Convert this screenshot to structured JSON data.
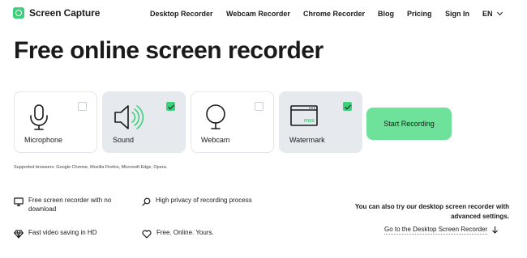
{
  "brand": {
    "name": "Screen Capture",
    "color": "#3ecf7a"
  },
  "nav": {
    "items": [
      "Desktop Recorder",
      "Webcam Recorder",
      "Chrome Recorder",
      "Blog",
      "Pricing",
      "Sign In"
    ],
    "language": "EN"
  },
  "hero": {
    "title": "Free online screen recorder"
  },
  "options": [
    {
      "label": "Microphone",
      "checked": false,
      "icon": "microphone-icon"
    },
    {
      "label": "Sound",
      "checked": true,
      "icon": "speaker-icon"
    },
    {
      "label": "Webcam",
      "checked": false,
      "icon": "webcam-icon"
    },
    {
      "label": "Watermark",
      "checked": true,
      "icon": "watermark-icon",
      "badge": "FREE"
    }
  ],
  "start_button": {
    "label": "Start Recording",
    "color": "#6ee29a"
  },
  "supported_browsers": "Supported browsers: Google Chrome, Mozilla Firefox, Microsoft Edge, Opera.",
  "features": [
    {
      "text": "Free screen recorder with no download",
      "icon": "monitor-icon"
    },
    {
      "text": "High privacy of recording process",
      "icon": "search-icon"
    },
    {
      "text": "Fast video saving in HD",
      "icon": "diamond-icon"
    },
    {
      "text": "Free. Online. Yours.",
      "icon": "heart-icon"
    }
  ],
  "desktop": {
    "text": "You can also try our desktop screen recorder with advanced settings.",
    "link": "Go to the Desktop Screen Recorder"
  }
}
